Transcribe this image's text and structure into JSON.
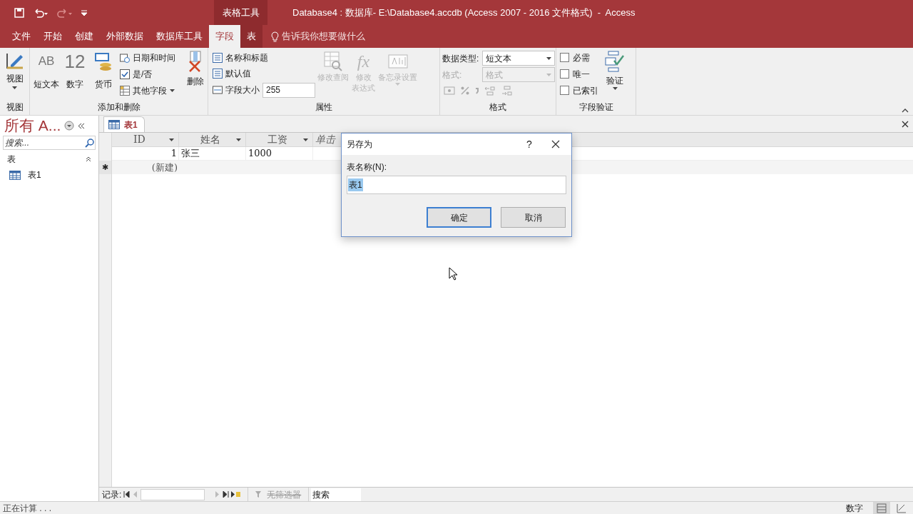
{
  "window": {
    "title": "Database4 : 数据库- E:\\Database4.accdb (Access 2007 - 2016 文件格式)  -  Access",
    "context_tab": "表格工具"
  },
  "ribbon_tabs": [
    {
      "label": "文件",
      "selected": false
    },
    {
      "label": "开始",
      "selected": false
    },
    {
      "label": "创建",
      "selected": false
    },
    {
      "label": "外部数据",
      "selected": false
    },
    {
      "label": "数据库工具",
      "selected": false
    },
    {
      "label": "字段",
      "selected": true
    },
    {
      "label": "表",
      "selected": false
    }
  ],
  "tell_me": "告诉我你想要做什么",
  "groups": {
    "view": {
      "label": "视图",
      "button": "视图"
    },
    "add_delete": {
      "label": "添加和删除",
      "large_buttons": [
        {
          "label": "短文本",
          "glyph": "AB"
        },
        {
          "label": "数字",
          "glyph": "12"
        },
        {
          "label": "货币"
        }
      ],
      "small_buttons": [
        "日期和时间",
        "是/否",
        "其他字段"
      ],
      "delete": "删除"
    },
    "properties": {
      "label": "属性",
      "small_buttons": [
        "名称和标题",
        "默认值"
      ],
      "field_size": {
        "label": "字段大小",
        "value": "255"
      },
      "large_buttons": [
        {
          "lines": [
            "修改查阅"
          ],
          "disabled": true
        },
        {
          "lines": [
            "修改",
            "表达式"
          ],
          "glyph": "fx",
          "disabled": true
        },
        {
          "lines": [
            "备忘录设置"
          ],
          "disabled": true
        }
      ]
    },
    "format": {
      "label": "格式",
      "data_type": {
        "label": "数据类型:",
        "value": "短文本",
        "disabled": false
      },
      "format": {
        "label": "格式:",
        "value": "格式",
        "disabled": true
      }
    },
    "validation": {
      "label": "字段验证",
      "checkboxes": [
        {
          "label": "必需",
          "checked": false
        },
        {
          "label": "唯一",
          "checked": false
        },
        {
          "label": "已索引",
          "checked": false
        }
      ],
      "button": "验证"
    }
  },
  "nav": {
    "title": "所有 A...",
    "search_placeholder": "搜索...",
    "section": "表",
    "items": [
      {
        "label": "表1"
      }
    ]
  },
  "document_tab": "表1",
  "table": {
    "columns": [
      "ID",
      "姓名",
      "工资",
      "单击"
    ],
    "rows": [
      {
        "cells": [
          "1",
          "张三",
          "1000"
        ]
      }
    ],
    "new_row": {
      "marker": "✱",
      "label": "(新建)"
    }
  },
  "dialog": {
    "title": "另存为",
    "help": "?",
    "label": "表名称(N):",
    "value": "表1",
    "buttons": [
      {
        "label": "确定",
        "default": true
      },
      {
        "label": "取消",
        "default": false
      }
    ]
  },
  "record_nav": {
    "label": "记录:",
    "filter": "无筛选器",
    "search": "搜索"
  },
  "status_bar": {
    "text": "正在计算 . . .",
    "mode": "数字"
  }
}
